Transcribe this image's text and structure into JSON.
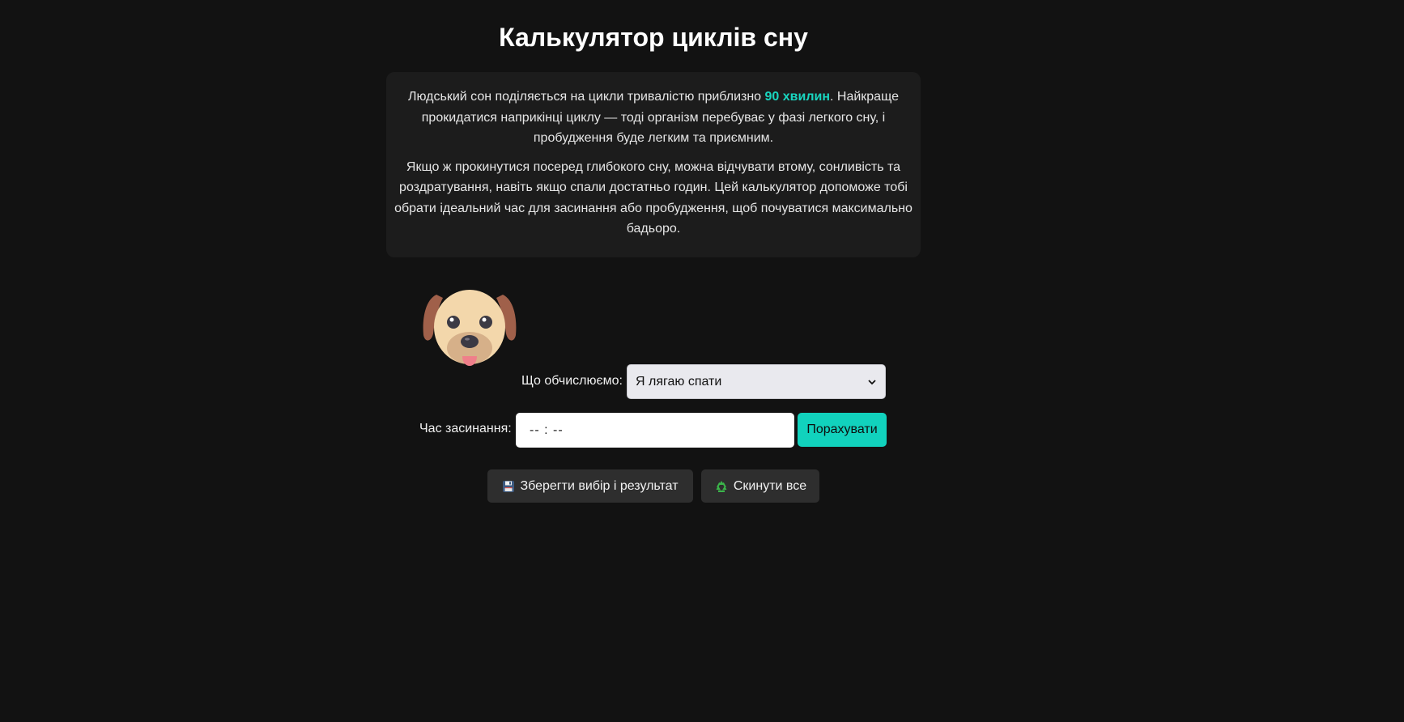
{
  "page": {
    "title": "Калькулятор циклів сну"
  },
  "intro": {
    "p1_before": "Людський сон поділяється на цикли тривалістю приблизно ",
    "p1_highlight": "90 хвилин",
    "p1_after": ". Найкраще прокидатися наприкінці циклу — тоді організм перебуває у фазі легкого сну, і пробудження буде легким та приємним.",
    "p2": "Якщо ж прокинутися посеред глибокого сну, можна відчувати втому, сонливість та роздратування, навіть якщо спали достатньо годин. Цей калькулятор допоможе тобі обрати ідеальний час для засинання або пробудження, щоб почуватися максимально бадьоро."
  },
  "form": {
    "mode_label": "Що обчислюємо:",
    "mode_selected": "Я лягаю спати",
    "time_label": "Час засинання:",
    "time_value": "-- : --",
    "calculate_label": "Порахувати"
  },
  "actions": {
    "save_label": "Зберегти вибір і результат",
    "reset_label": "Скинути все"
  },
  "icons": {
    "mascot": "dog-face-icon",
    "save": "floppy-disk-icon",
    "reset": "recycle-icon",
    "dropdown": "chevron-down-icon"
  },
  "colors": {
    "background": "#121212",
    "panel": "#1c1c1c",
    "accent": "#19d6c0",
    "button_dark": "#2e2e2e"
  }
}
